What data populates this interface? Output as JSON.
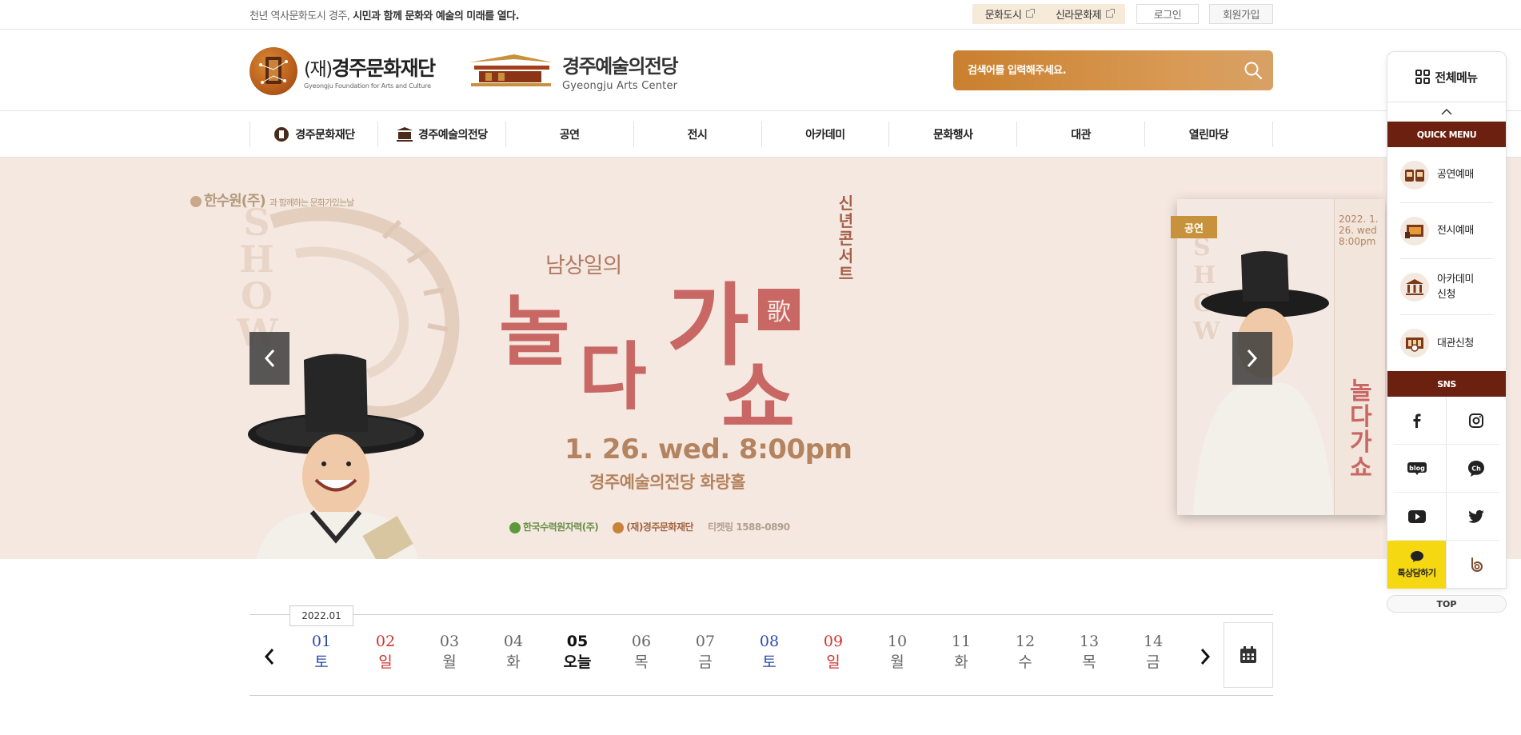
{
  "topbar": {
    "tagline_plain": "천년 역사문화도시 경주,",
    "tagline_bold": "시민과 함께 문화와 예술의 미래를 열다.",
    "links": [
      {
        "label": "문화도시"
      },
      {
        "label": "신라문화제"
      }
    ],
    "login": "로그인",
    "join": "회원가입"
  },
  "header": {
    "logo1_prefix": "(재)",
    "logo1_name": "경주문화재단",
    "logo1_en": "Gyeongju Foundation for Arts and Culture",
    "logo2_name": "경주예술의전당",
    "logo2_en": "Gyeongju Arts Center",
    "search_placeholder": "검색어를 입력해주세요."
  },
  "nav": {
    "items": [
      {
        "label": "경주문화재단",
        "icon": "foundation-icon"
      },
      {
        "label": "경주예술의전당",
        "icon": "arts-center-icon"
      },
      {
        "label": "공연"
      },
      {
        "label": "전시"
      },
      {
        "label": "아카데미"
      },
      {
        "label": "문화행사"
      },
      {
        "label": "대관"
      },
      {
        "label": "열린마당"
      }
    ]
  },
  "hero": {
    "sponsor": "한수원(주)",
    "sponsor_sub": "과 함께하는 문화가있는날",
    "show_letters": "SHOW",
    "subtitle": "남상일의",
    "title_chars": [
      "놀",
      "다",
      "가",
      "쇼"
    ],
    "seal_char": "歌",
    "vertical": "신년콘서트",
    "date": "1. 26. wed. 8:00pm",
    "venue": "경주예술의전당  화랑홀",
    "footer_1": "한국수력원자력(주)",
    "footer_2": "(재)경주문화재단",
    "footer_3": "티켓링 1588-0890",
    "poster_tag": "공연",
    "poster_date": "2022. 1. 26. wed 8:00pm",
    "poster_title": "놀다가쇼"
  },
  "calendar": {
    "month": "2022.01",
    "days": [
      {
        "num": "01",
        "wd": "토",
        "type": "sat"
      },
      {
        "num": "02",
        "wd": "일",
        "type": "sun"
      },
      {
        "num": "03",
        "wd": "월",
        "type": ""
      },
      {
        "num": "04",
        "wd": "화",
        "type": ""
      },
      {
        "num": "05",
        "wd": "오늘",
        "type": "today"
      },
      {
        "num": "06",
        "wd": "목",
        "type": ""
      },
      {
        "num": "07",
        "wd": "금",
        "type": ""
      },
      {
        "num": "08",
        "wd": "토",
        "type": "sat"
      },
      {
        "num": "09",
        "wd": "일",
        "type": "sun"
      },
      {
        "num": "10",
        "wd": "월",
        "type": ""
      },
      {
        "num": "11",
        "wd": "화",
        "type": ""
      },
      {
        "num": "12",
        "wd": "수",
        "type": ""
      },
      {
        "num": "13",
        "wd": "목",
        "type": ""
      },
      {
        "num": "14",
        "wd": "금",
        "type": ""
      }
    ]
  },
  "quick": {
    "all_menu": "전체메뉴",
    "quick_title": "QUICK MENU",
    "items": [
      {
        "label": "공연예매",
        "icon": "performance-ticket-icon"
      },
      {
        "label": "전시예매",
        "icon": "exhibition-ticket-icon"
      },
      {
        "label": "아카데미 신청",
        "icon": "academy-icon"
      },
      {
        "label": "대관신청",
        "icon": "rental-icon"
      }
    ],
    "sns_title": "SNS",
    "kakao_label": "톡상담하기",
    "top": "TOP"
  },
  "colors": {
    "accent_brown": "#6b2010",
    "search_orange": "#c9802e",
    "hero_bg": "#f5e8e0",
    "hero_red": "#c86764",
    "sat_blue": "#2e4bab",
    "sun_red": "#d0322d"
  }
}
